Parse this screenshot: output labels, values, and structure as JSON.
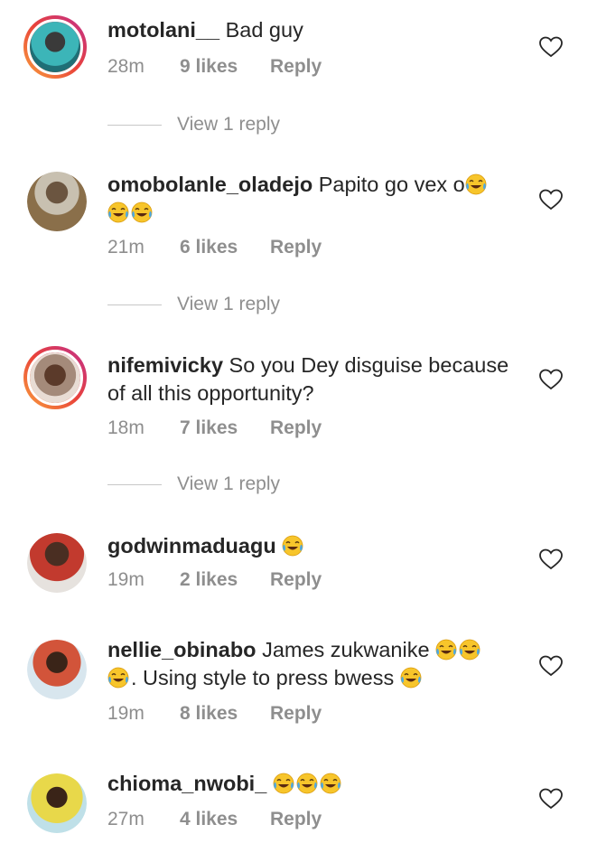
{
  "comments": [
    {
      "username": "motolani__",
      "body": "Bad guy",
      "time": "28m",
      "likes": "9 likes",
      "reply": "Reply",
      "view_replies": "View 1 reply",
      "avatar": "story-ring"
    },
    {
      "username": "omobolanle_oladejo",
      "body": "Papito go vex o",
      "time": "21m",
      "likes": "6 likes",
      "reply": "Reply",
      "view_replies": "View 1 reply",
      "avatar": "plain"
    },
    {
      "username": "nifemivicky",
      "body": "So you Dey disguise because of all this opportunity?",
      "time": "18m",
      "likes": "7 likes",
      "reply": "Reply",
      "view_replies": "View 1 reply",
      "avatar": "story-ring"
    },
    {
      "username": "godwinmaduagu",
      "body": "",
      "time": "19m",
      "likes": "2 likes",
      "reply": "Reply",
      "avatar": "plain"
    },
    {
      "username": "nellie_obinabo",
      "body_part1": "James zukwanike",
      "body_part2": ". Using style to press bwess",
      "time": "19m",
      "likes": "8 likes",
      "reply": "Reply",
      "avatar": "plain"
    },
    {
      "username": "chioma_nwobi_",
      "body": "",
      "time": "27m",
      "likes": "4 likes",
      "reply": "Reply",
      "avatar": "plain"
    }
  ],
  "icons": {
    "like": "heart-outline-icon",
    "emoji": "face-with-tears-of-joy-emoji"
  },
  "colors": {
    "text": "#262626",
    "meta": "#8e8e8e",
    "story_ring_start": "#f9a13c",
    "story_ring_end": "#c12f8d"
  }
}
